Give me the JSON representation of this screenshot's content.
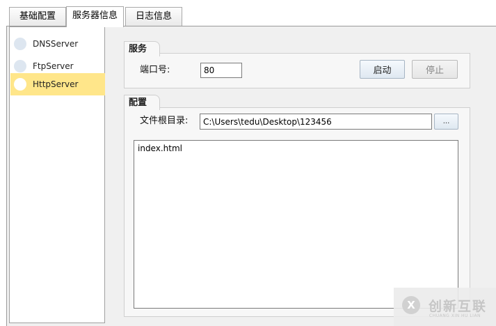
{
  "tabs": [
    {
      "label": "基础配置",
      "active": false
    },
    {
      "label": "服务器信息",
      "active": true
    },
    {
      "label": "日志信息",
      "active": false
    }
  ],
  "server_list": {
    "items": [
      {
        "label": "DNSServer",
        "selected": false,
        "icon": "circle-icon"
      },
      {
        "label": "FtpServer",
        "selected": false,
        "icon": "circle-icon"
      },
      {
        "label": "HttpServer",
        "selected": true,
        "icon": "circle-icon"
      }
    ]
  },
  "service_group": {
    "title": "服务",
    "port_label": "端口号:",
    "port_value": "80",
    "start_label": "启动",
    "stop_label": "停止"
  },
  "config_group": {
    "title": "配置",
    "root_dir_label": "文件根目录:",
    "root_dir_value": "C:\\Users\\tedu\\Desktop\\123456",
    "browse_label": "...",
    "files": [
      "index.html"
    ]
  },
  "watermark": {
    "logo_glyph": "X",
    "cn_text": "创新互联",
    "en_text": "CHUANG XIN HU LIAN"
  },
  "colors": {
    "selected_item": "#ffe68a",
    "panel_bg": "#f0f0f0",
    "group_bg": "#f7f7f7"
  }
}
